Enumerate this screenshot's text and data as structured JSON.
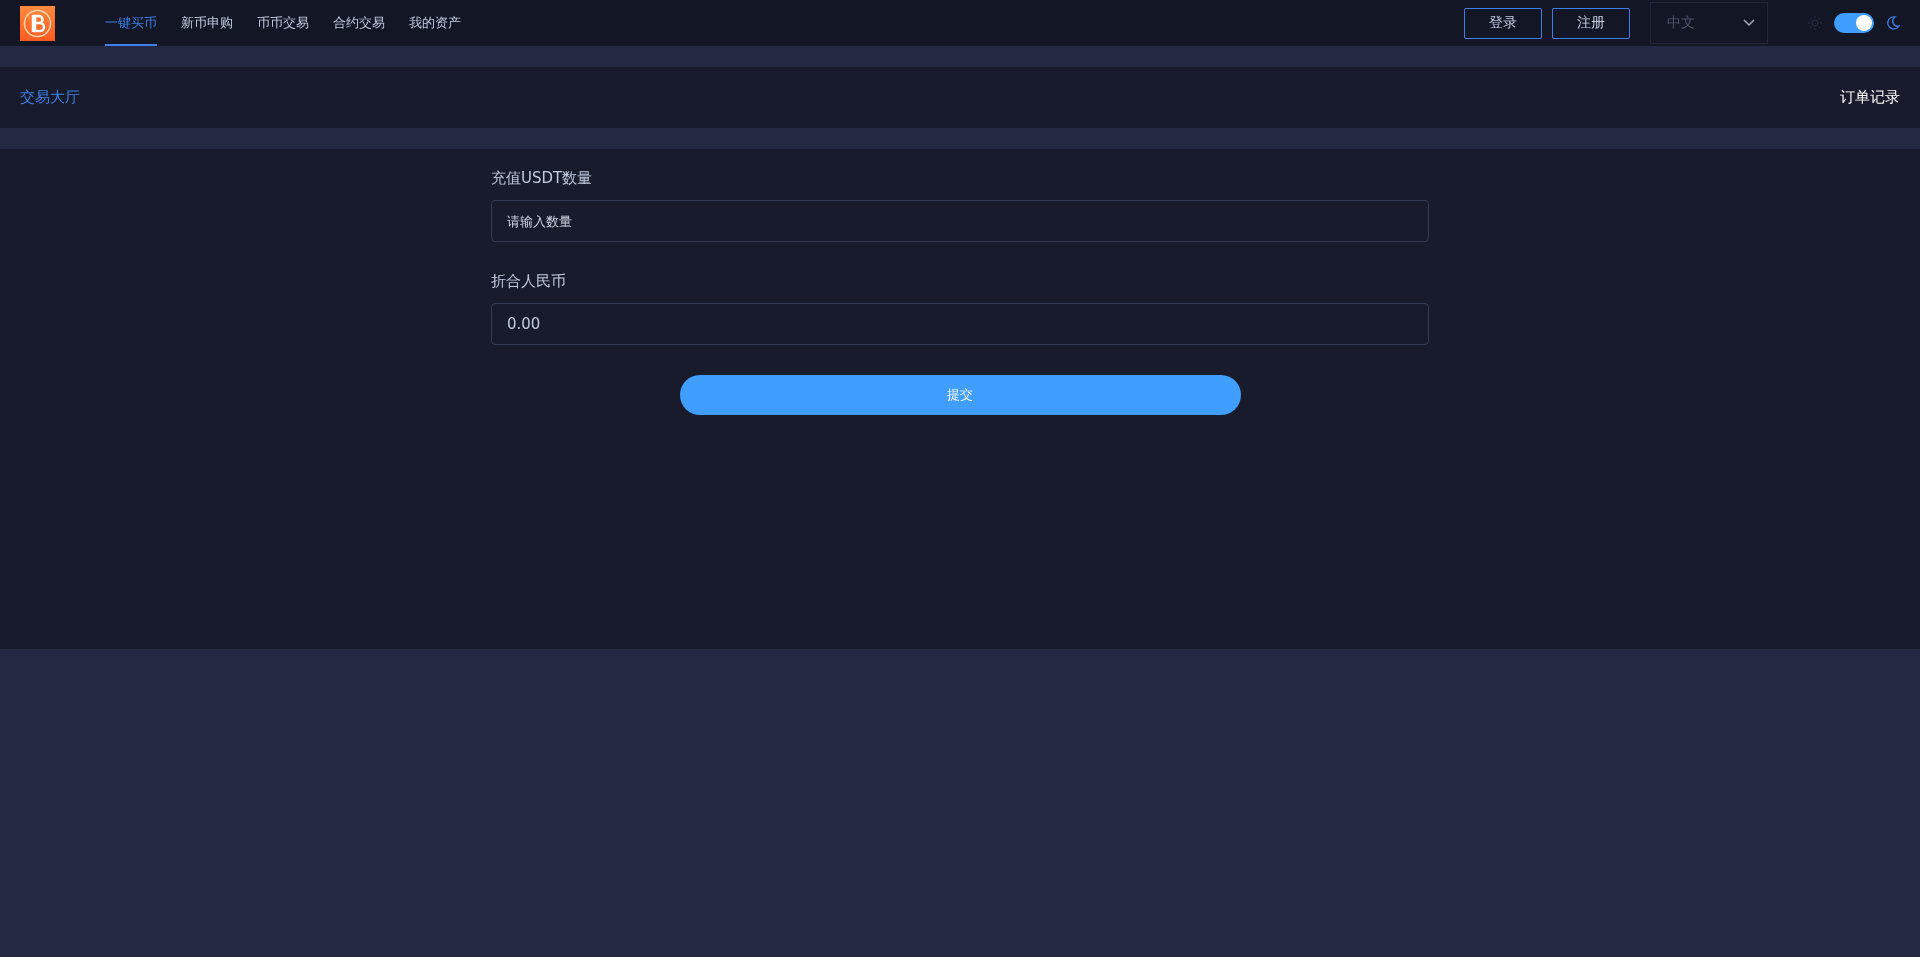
{
  "nav": {
    "items": [
      {
        "label": "一键买币",
        "selected": true
      },
      {
        "label": "新币申购",
        "selected": false
      },
      {
        "label": "币币交易",
        "selected": false
      },
      {
        "label": "合约交易",
        "selected": false
      },
      {
        "label": "我的资产",
        "selected": false
      }
    ],
    "login": "登录",
    "register": "注册",
    "language": "中文",
    "dark_mode": true
  },
  "subheader": {
    "title": "交易大厅",
    "link": "订单记录"
  },
  "form": {
    "fields": [
      {
        "label": "充值USDT数量",
        "placeholder": "请输入数量"
      },
      {
        "label": "折合人民币",
        "value": "0.00"
      }
    ],
    "submit": "提交"
  }
}
